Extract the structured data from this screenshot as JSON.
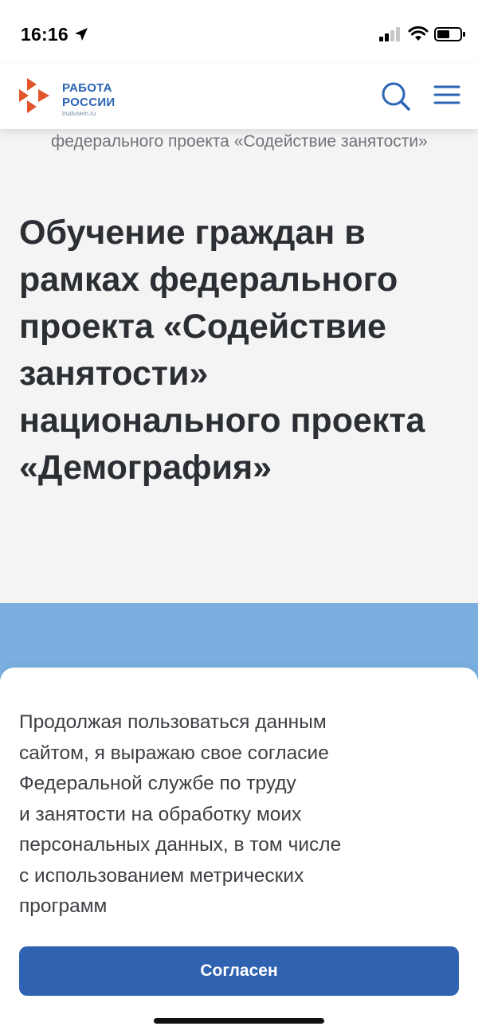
{
  "status_bar": {
    "time": "16:16",
    "icons": [
      "location-arrow-icon",
      "cellular-signal-icon",
      "wifi-icon",
      "battery-icon"
    ]
  },
  "header": {
    "logo": {
      "line1": "РАБОТА",
      "line2": "РОССИИ",
      "url": "trudvsem.ru"
    },
    "icons": [
      "search-icon",
      "hamburger-menu-icon"
    ],
    "colors": {
      "brand_blue": "#2b64b4",
      "logo_orange": "#e2552b"
    }
  },
  "breadcrumb": {
    "text": "федерального проекта «Содействие занятости»"
  },
  "page_title": "Обучение граждан в рамках федерального проекта «Содействие занятости» национального проекта «Демография»",
  "colors": {
    "band_blue": "#7aafdf",
    "button_blue": "#2f62b0",
    "page_bg": "#f4f4f5"
  },
  "consent": {
    "lines": [
      "Продолжая пользоваться данным",
      "сайтом, я выражаю свое согласие",
      "Федеральной службе по труду",
      "и занятости на обработку моих",
      "персональных данных, в том числе",
      "с использованием метрических",
      "программ"
    ],
    "button_label": "Согласен"
  }
}
